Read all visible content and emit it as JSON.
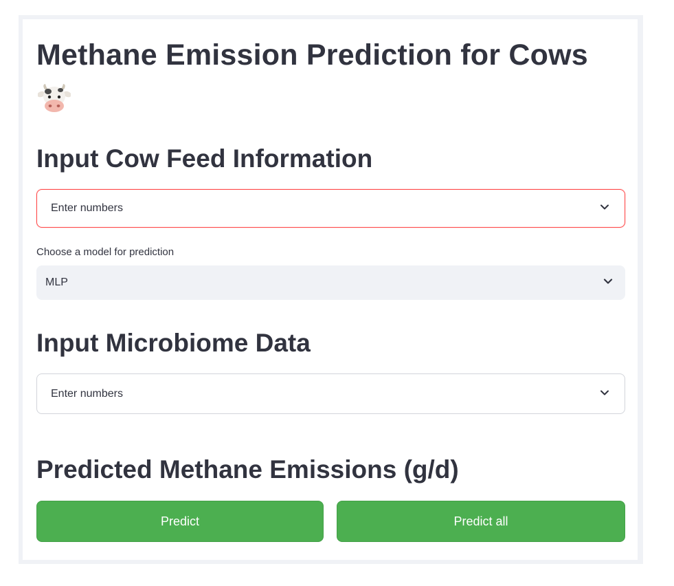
{
  "header": {
    "title": "Methane Emission Prediction for Cows",
    "title_icon": "cow-face-icon"
  },
  "feed_section": {
    "heading": "Input Cow Feed Information",
    "select": {
      "value": "Enter numbers",
      "icon": "chevron-down-icon",
      "state": "focused"
    }
  },
  "model_section": {
    "label": "Choose a model for prediction",
    "select": {
      "value": "MLP",
      "icon": "chevron-down-icon"
    }
  },
  "microbiome_section": {
    "heading": "Input Microbiome Data",
    "select": {
      "value": "Enter numbers",
      "icon": "chevron-down-icon"
    }
  },
  "prediction_section": {
    "heading": "Predicted Methane Emissions (g/d)",
    "predict_label": "Predict",
    "predict_all_label": "Predict all"
  },
  "colors": {
    "accent_focus": "#ff4b4b",
    "button_green": "#4caf50",
    "text": "#31333f",
    "muted_bg": "#f0f2f6"
  }
}
